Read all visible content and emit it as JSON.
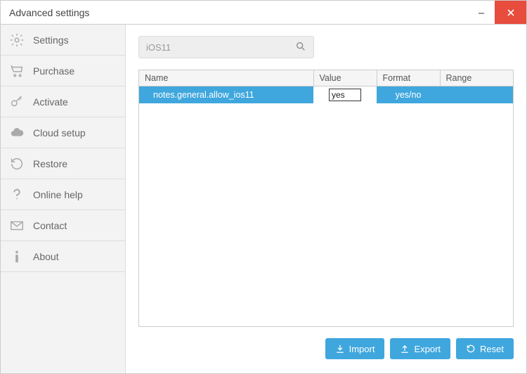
{
  "window": {
    "title": "Advanced settings"
  },
  "sidebar": {
    "items": [
      {
        "label": "Settings",
        "icon": "gear-icon"
      },
      {
        "label": "Purchase",
        "icon": "cart-icon"
      },
      {
        "label": "Activate",
        "icon": "key-icon"
      },
      {
        "label": "Cloud setup",
        "icon": "cloud-icon"
      },
      {
        "label": "Restore",
        "icon": "restore-icon"
      },
      {
        "label": "Online help",
        "icon": "question-icon"
      },
      {
        "label": "Contact",
        "icon": "mail-icon"
      },
      {
        "label": "About",
        "icon": "info-icon"
      }
    ]
  },
  "search": {
    "value": "iOS11"
  },
  "table": {
    "columns": [
      "Name",
      "Value",
      "Format",
      "Range"
    ],
    "rows": [
      {
        "name": "notes.general.allow_ios11",
        "value": "yes",
        "format": "yes/no",
        "range": ""
      }
    ]
  },
  "buttons": {
    "import": "Import",
    "export": "Export",
    "reset": "Reset"
  }
}
